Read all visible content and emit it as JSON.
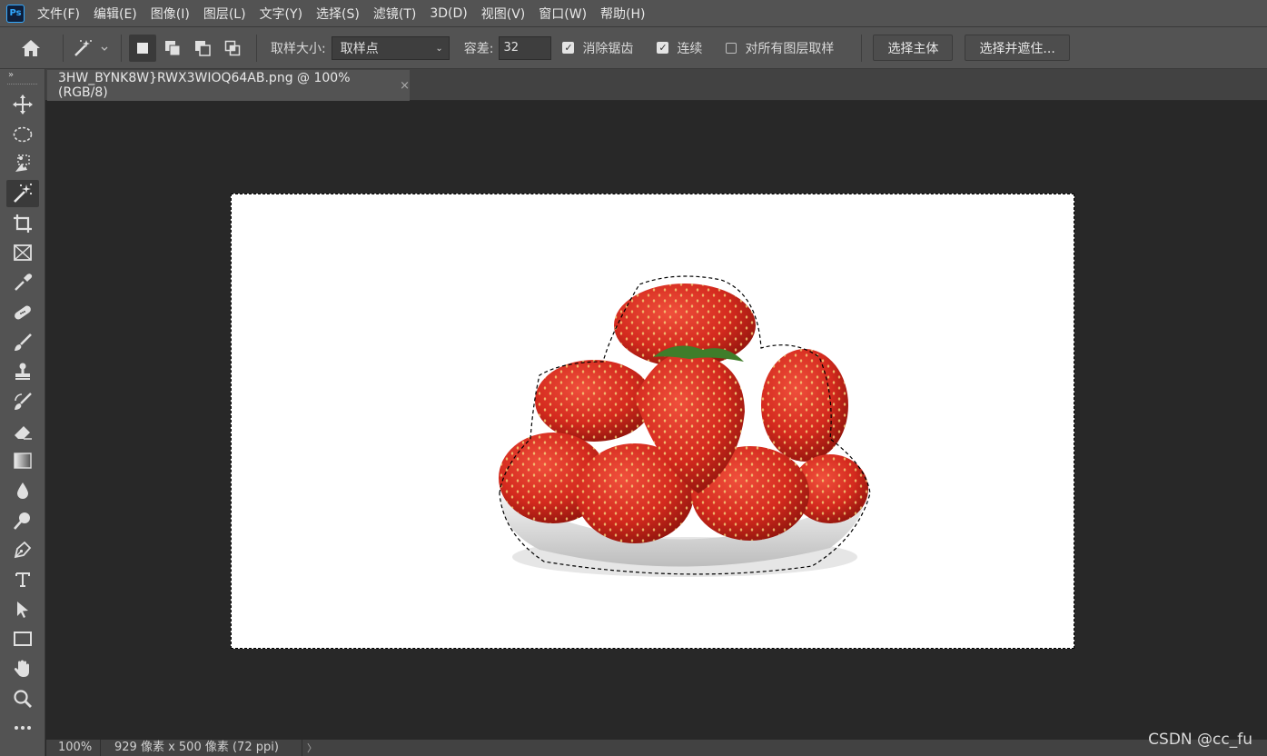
{
  "app": {
    "logo_text": "Ps"
  },
  "menubar": {
    "items": [
      "文件(F)",
      "编辑(E)",
      "图像(I)",
      "图层(L)",
      "文字(Y)",
      "选择(S)",
      "滤镜(T)",
      "3D(D)",
      "视图(V)",
      "窗口(W)",
      "帮助(H)"
    ]
  },
  "options": {
    "sample_size_label": "取样大小:",
    "sample_size_value": "取样点",
    "tolerance_label": "容差:",
    "tolerance_value": "32",
    "anti_alias_label": "消除锯齿",
    "anti_alias_checked": true,
    "contiguous_label": "连续",
    "contiguous_checked": true,
    "sample_all_layers_label": "对所有图层取样",
    "sample_all_layers_checked": false,
    "select_subject_label": "选择主体",
    "select_and_mask_label": "选择并遮住..."
  },
  "document": {
    "tab_title": "3HW_BYNK8W}RWX3WIOQ64AB.png @ 100%(RGB/8)",
    "close_symbol": "×"
  },
  "status": {
    "zoom": "100%",
    "doc_info": "929 像素 x 500 像素 (72 ppi)",
    "arrow": "〉"
  },
  "watermark": "CSDN @cc_fu",
  "colors": {
    "panel": "#535353",
    "canvas_bg": "#282828",
    "accent": "#31a8ff",
    "strawberry": "#d42a1e"
  },
  "tools": [
    "move-icon",
    "ellipse-marquee-icon",
    "object-selection-icon",
    "magic-wand-icon",
    "crop-icon",
    "frame-icon",
    "eyedropper-icon",
    "healing-brush-icon",
    "brush-icon",
    "clone-stamp-icon",
    "history-brush-icon",
    "eraser-icon",
    "gradient-icon",
    "blur-icon",
    "dodge-icon",
    "pen-icon",
    "type-icon",
    "path-selection-icon",
    "rectangle-icon",
    "hand-icon",
    "zoom-icon",
    "more-tools-icon"
  ]
}
